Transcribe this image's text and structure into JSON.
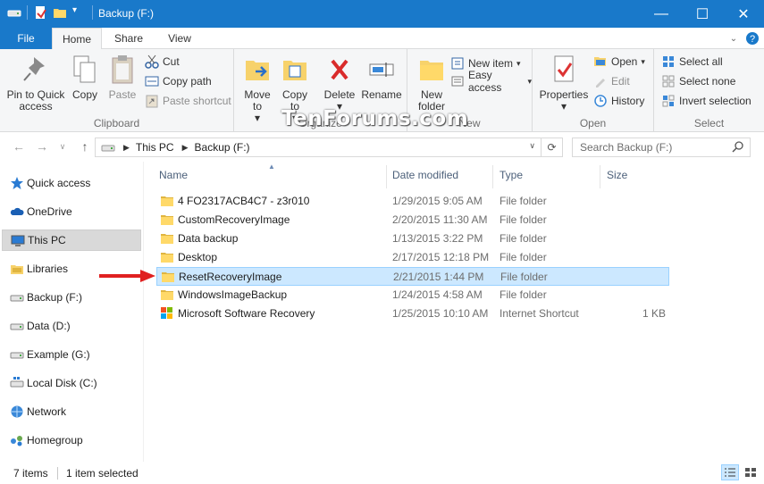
{
  "window": {
    "title": "Backup (F:)",
    "controls": {
      "minimize": "—",
      "maximize": "☐",
      "close": "✕"
    }
  },
  "tabs": {
    "file": "File",
    "home": "Home",
    "share": "Share",
    "view": "View"
  },
  "watermark": "TenForums.com",
  "ribbon": {
    "clipboard": {
      "label": "Clipboard",
      "pin": "Pin to Quick access",
      "copy": "Copy",
      "paste": "Paste",
      "cut": "Cut",
      "copy_path": "Copy path",
      "paste_shortcut": "Paste shortcut"
    },
    "organize": {
      "label": "Organize",
      "move_to": "Move to",
      "copy_to": "Copy to",
      "delete": "Delete",
      "rename": "Rename"
    },
    "new": {
      "label": "New",
      "new_folder": "New folder",
      "new_item": "New item",
      "easy_access": "Easy access"
    },
    "open": {
      "label": "Open",
      "properties": "Properties",
      "open": "Open",
      "edit": "Edit",
      "history": "History"
    },
    "select": {
      "label": "Select",
      "select_all": "Select all",
      "select_none": "Select none",
      "invert_selection": "Invert selection"
    }
  },
  "address": {
    "crumbs": [
      "This PC",
      "Backup (F:)"
    ],
    "search_placeholder": "Search Backup (F:)"
  },
  "nav": {
    "items": [
      {
        "label": "Quick access",
        "icon": "star-icon"
      },
      {
        "label": "OneDrive",
        "icon": "cloud-icon"
      },
      {
        "label": "This PC",
        "icon": "computer-icon"
      },
      {
        "label": "Libraries",
        "icon": "library-icon"
      },
      {
        "label": "Backup (F:)",
        "icon": "drive-icon"
      },
      {
        "label": "Data (D:)",
        "icon": "drive-icon"
      },
      {
        "label": "Example (G:)",
        "icon": "drive-icon"
      },
      {
        "label": "Local Disk (C:)",
        "icon": "windows-drive-icon"
      },
      {
        "label": "Network",
        "icon": "network-icon"
      },
      {
        "label": "Homegroup",
        "icon": "homegroup-icon"
      }
    ]
  },
  "columns": {
    "name": "Name",
    "date": "Date modified",
    "type": "Type",
    "size": "Size"
  },
  "files": [
    {
      "name": "4 FO2317ACB4C7 - z3r010",
      "date": "1/29/2015 9:05 AM",
      "type": "File folder",
      "size": ""
    },
    {
      "name": "CustomRecoveryImage",
      "date": "2/20/2015 11:30 AM",
      "type": "File folder",
      "size": ""
    },
    {
      "name": "Data backup",
      "date": "1/13/2015 3:22 PM",
      "type": "File folder",
      "size": ""
    },
    {
      "name": "Desktop",
      "date": "2/17/2015 12:18 PM",
      "type": "File folder",
      "size": ""
    },
    {
      "name": "ResetRecoveryImage",
      "date": "2/21/2015 1:44 PM",
      "type": "File folder",
      "size": ""
    },
    {
      "name": "WindowsImageBackup",
      "date": "1/24/2015 4:58 AM",
      "type": "File folder",
      "size": ""
    },
    {
      "name": "Microsoft Software Recovery",
      "date": "1/25/2015 10:10 AM",
      "type": "Internet Shortcut",
      "size": "1 KB"
    }
  ],
  "status": {
    "items": "7 items",
    "selected": "1 item selected"
  },
  "colors": {
    "accent": "#1979ca",
    "selection": "#cce8ff",
    "arrow": "#e02020"
  }
}
